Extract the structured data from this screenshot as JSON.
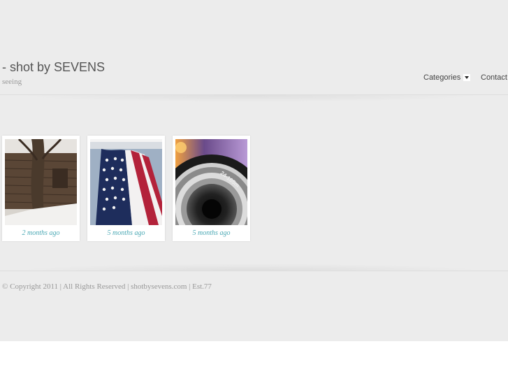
{
  "header": {
    "site_title": "- shot by SEVENS",
    "tagline": "seeing"
  },
  "nav": {
    "categories_label": "Categories",
    "contact_label": "Contact"
  },
  "gallery": {
    "items": [
      {
        "caption": "2 months ago",
        "subject": "old-wooden-barn-with-tree"
      },
      {
        "caption": "5 months ago",
        "subject": "american-flag"
      },
      {
        "caption": "5 months ago",
        "subject": "camera-lens-24-105mm",
        "lens_text": "24-105m"
      }
    ]
  },
  "footer": {
    "copyright": "© Copyright 2011 | All Rights Reserved | shotbysevens.com | Est.77"
  },
  "colors": {
    "background": "#ececec",
    "caption": "#4aa8b4",
    "title": "#555555"
  }
}
